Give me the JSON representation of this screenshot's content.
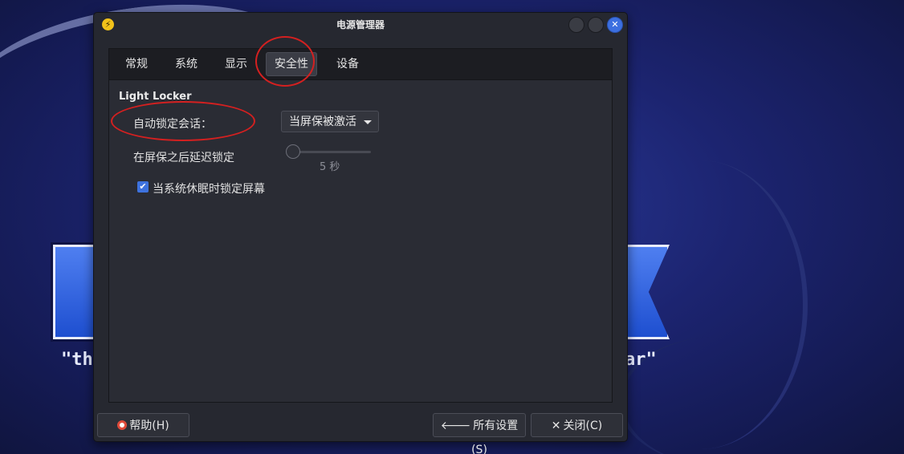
{
  "window": {
    "title": "电源管理器",
    "app_icon": "lightning-icon",
    "controls": [
      "minimize-button",
      "maximize-button",
      "close-button"
    ]
  },
  "tabs": [
    {
      "label": "常规",
      "active": false
    },
    {
      "label": "系统",
      "active": false
    },
    {
      "label": "显示",
      "active": false
    },
    {
      "label": "安全性",
      "active": true
    },
    {
      "label": "设备",
      "active": false
    }
  ],
  "security": {
    "section_title": "Light Locker",
    "auto_lock_label": "自动锁定会话：",
    "auto_lock_value": "当屏保被激活",
    "delay_label": "在屏保之后延迟锁定",
    "delay_value": "5 秒",
    "delay_seconds": 5,
    "lock_on_sleep_label": "当系统休眠时锁定屏幕",
    "lock_on_sleep_checked": true
  },
  "buttons": {
    "help": "帮助(H)",
    "all_settings": "所有设置(S)",
    "close": "关闭(C)"
  },
  "desktop": {
    "left_text": "\"th",
    "right_text": "ar\""
  },
  "colors": {
    "accent": "#3d72de",
    "annotation": "#d42020",
    "window_bg": "#262830"
  }
}
